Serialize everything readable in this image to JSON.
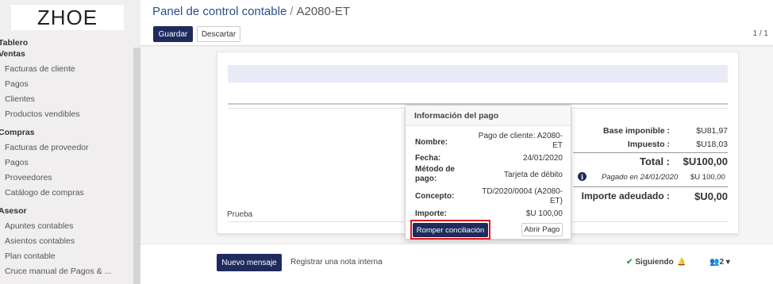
{
  "sidebar": {
    "logo": "ZHOE",
    "dashboard": "Tablero",
    "sections": [
      {
        "title": "Ventas",
        "items": [
          "Facturas de cliente",
          "Pagos",
          "Clientes",
          "Productos vendibles"
        ]
      },
      {
        "title": "Compras",
        "items": [
          "Facturas de proveedor",
          "Pagos",
          "Proveedores",
          "Catálogo de compras"
        ]
      },
      {
        "title": "Asesor",
        "items": [
          "Apuntes contables",
          "Asientos contables",
          "Plan contable",
          "Cruce manual de Pagos & ..."
        ]
      }
    ]
  },
  "header": {
    "breadcrumb_parent": "Panel de control contable",
    "breadcrumb_separator": "/",
    "breadcrumb_current": "A2080-ET",
    "save_label": "Guardar",
    "discard_label": "Descartar",
    "pager": "1 / 1"
  },
  "invoice": {
    "note": "Prueba",
    "totals": {
      "base_label": "Base imponible :",
      "base_value": "$U81,97",
      "tax_label": "Impuesto :",
      "tax_value": "$U18,03",
      "total_label": "Total :",
      "total_value": "$U100,00",
      "paid_text": "Pagado en 24/01/2020",
      "paid_amount": "$U 100,00",
      "due_label": "Importe adeudado :",
      "due_value": "$U0,00"
    }
  },
  "popover": {
    "title": "Información del pago",
    "name_label": "Nombre:",
    "name_value": "Pago de cliente: A2080-ET",
    "date_label": "Fecha:",
    "date_value": "24/01/2020",
    "method_label": "Método de pago:",
    "method_value": "Tarjeta de débito",
    "concept_label": "Concepto:",
    "concept_value": "TD/2020/0004 (A2080-ET)",
    "amount_label": "Importe:",
    "amount_value": "$U 100,00",
    "unreconcile_label": "Romper conciliación",
    "open_label": "Abrir Pago"
  },
  "chatter": {
    "new_message": "Nuevo mensaje",
    "log_note": "Registrar una nota interna",
    "following": "Siguiendo",
    "followers": "2"
  },
  "colors": {
    "primary": "#1e2b5c",
    "highlight": "#e0181c"
  }
}
